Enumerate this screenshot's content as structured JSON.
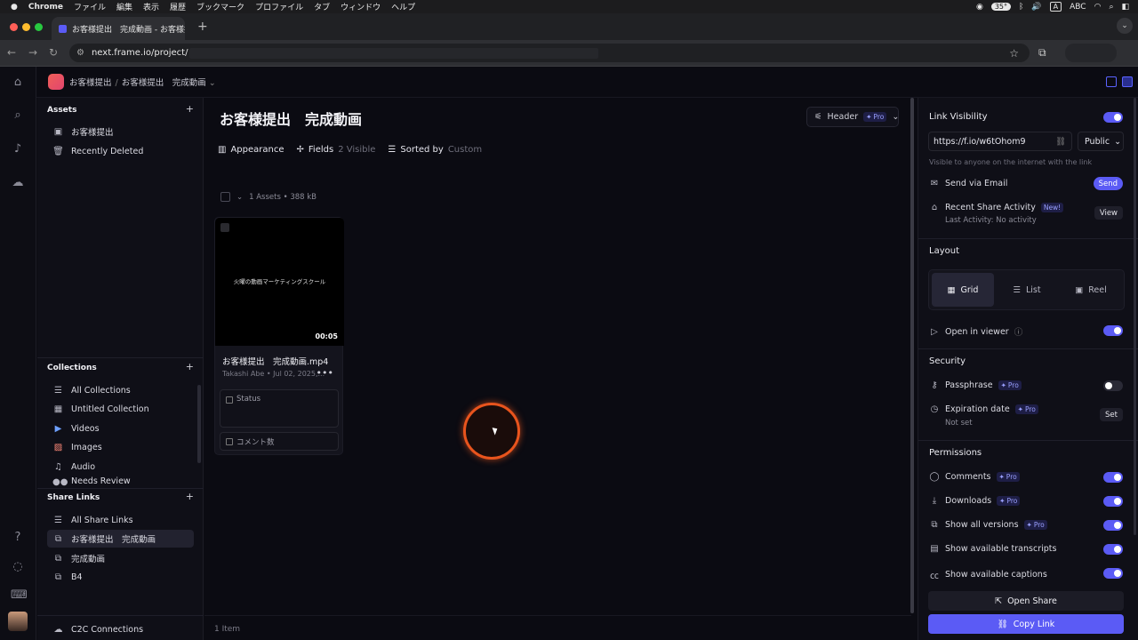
{
  "menubar": {
    "app": "Chrome",
    "items": [
      "ファイル",
      "編集",
      "表示",
      "履歴",
      "ブックマーク",
      "プロファイル",
      "タブ",
      "ウィンドウ",
      "ヘルプ"
    ],
    "temp": "35°",
    "input": "A",
    "input_label": "ABC"
  },
  "browser": {
    "tab_title": "お客様提出　完成動画 - お客様提出",
    "url": "next.frame.io/project/"
  },
  "topbar": {
    "crumb1": "お客様提出",
    "crumb_sep": "/",
    "crumb2": "お客様提出　完成動画"
  },
  "sidebar": {
    "assets_header": "Assets",
    "assets": [
      {
        "label": "お客様提出",
        "icon": "folder-icon"
      },
      {
        "label": "Recently Deleted",
        "icon": "trash-icon"
      }
    ],
    "collections_header": "Collections",
    "collections": [
      {
        "label": "All Collections",
        "icon": "list-icon"
      },
      {
        "label": "Untitled Collection",
        "icon": "collection-icon"
      },
      {
        "label": "Videos",
        "icon": "video-icon"
      },
      {
        "label": "Images",
        "icon": "image-icon"
      },
      {
        "label": "Audio",
        "icon": "audio-icon"
      },
      {
        "label": "Needs Review",
        "icon": "review-icon"
      }
    ],
    "share_header": "Share Links",
    "shares": [
      {
        "label": "All Share Links",
        "icon": "list-icon"
      },
      {
        "label": "お客様提出　完成動画",
        "icon": "share-icon"
      },
      {
        "label": "完成動画",
        "icon": "share-icon"
      },
      {
        "label": "B4",
        "icon": "share-icon"
      }
    ],
    "c2c": "C2C Connections"
  },
  "main": {
    "title": "お客様提出　完成動画",
    "header_btn": "Header",
    "pro": "Pro",
    "appearance": "Appearance",
    "fields": "Fields",
    "fields_count": "2 Visible",
    "sorted": "Sorted by",
    "sorted_value": "Custom",
    "bulk_info": "1 Assets • 388 kB",
    "item_count": "1 Item",
    "asset": {
      "thumb_text": "火曜の動画マーケティングスクール",
      "duration": "00:05",
      "name": "お客様提出　完成動画.mp4",
      "meta": "Takashi Abe • Jul 02, 2025,...",
      "field1": "Status",
      "field2": "コメント数"
    }
  },
  "panel": {
    "link_visibility": "Link Visibility",
    "link_url": "https://f.io/w6tOhom9",
    "visibility": "Public",
    "vis_note": "Visible to anyone on the internet with the link",
    "send_email": "Send via Email",
    "send_btn": "Send",
    "recent_activity": "Recent Share Activity",
    "new_badge": "New!",
    "last_activity": "Last Activity: No activity",
    "view_btn": "View",
    "layout_header": "Layout",
    "layout_grid": "Grid",
    "layout_list": "List",
    "layout_reel": "Reel",
    "open_viewer": "Open in viewer",
    "security_header": "Security",
    "passphrase": "Passphrase",
    "expiration": "Expiration date",
    "not_set": "Not set",
    "set_btn": "Set",
    "permissions_header": "Permissions",
    "comments": "Comments",
    "downloads": "Downloads",
    "show_versions": "Show all versions",
    "show_transcripts": "Show available transcripts",
    "show_captions": "Show available captions",
    "open_share": "Open Share",
    "copy_link": "Copy Link",
    "pro": "Pro"
  },
  "colors": {
    "accent": "#5b5bf5",
    "brand": "#f05f57",
    "cursor_ring": "#e8541d"
  }
}
